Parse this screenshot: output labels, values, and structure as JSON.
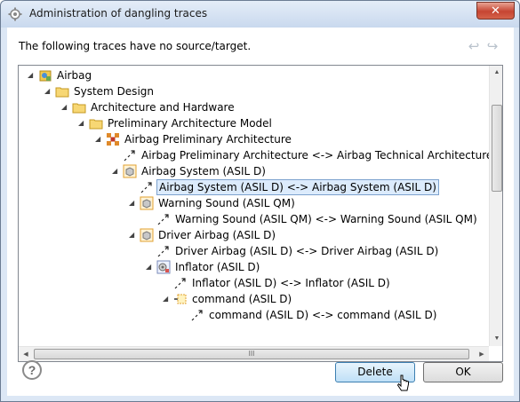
{
  "window": {
    "title": "Administration of dangling traces",
    "close_label": "✕"
  },
  "message": "The following traces have no source/target.",
  "tree": {
    "nodes": [
      {
        "label": "Airbag",
        "icon": "project-icon",
        "toggle": "◢"
      },
      {
        "label": "System Design",
        "icon": "folder-icon",
        "toggle": "◢"
      },
      {
        "label": "Architecture and Hardware",
        "icon": "folder-icon",
        "toggle": "◢"
      },
      {
        "label": "Preliminary Architecture Model",
        "icon": "folder-icon",
        "toggle": "◢"
      },
      {
        "label": "Airbag Preliminary Architecture",
        "icon": "architecture-icon",
        "toggle": "◢"
      },
      {
        "label": "Airbag Preliminary Architecture <-> Airbag Technical Architecture",
        "icon": "trace-icon",
        "toggle": ""
      },
      {
        "label": "Airbag System (ASIL D)",
        "icon": "system-icon",
        "toggle": "◢"
      },
      {
        "label": "Airbag System (ASIL D) <-> Airbag System (ASIL D)",
        "icon": "trace-icon",
        "toggle": ""
      },
      {
        "label": "Warning Sound (ASIL QM)",
        "icon": "component-icon",
        "toggle": "◢"
      },
      {
        "label": "Warning Sound (ASIL QM) <-> Warning Sound (ASIL QM)",
        "icon": "trace-icon",
        "toggle": ""
      },
      {
        "label": "Driver Airbag (ASIL D)",
        "icon": "component-icon",
        "toggle": "◢"
      },
      {
        "label": "Driver Airbag (ASIL D) <-> Driver Airbag (ASIL D)",
        "icon": "trace-icon",
        "toggle": ""
      },
      {
        "label": "Inflator (ASIL D)",
        "icon": "gear-component-icon",
        "toggle": "◢"
      },
      {
        "label": "Inflator (ASIL D) <-> Inflator (ASIL D)",
        "icon": "trace-icon",
        "toggle": ""
      },
      {
        "label": "command (ASIL D)",
        "icon": "port-icon",
        "toggle": "◢"
      },
      {
        "label": "command (ASIL D) <-> command (ASIL D)",
        "icon": "trace-icon",
        "toggle": ""
      }
    ],
    "selected_index": 7
  },
  "scroll": {
    "h_grip": "III"
  },
  "buttons": {
    "help_label": "?",
    "delete_label": "Delete",
    "ok_label": "OK"
  },
  "colors": {
    "selection": "#dcebfc",
    "folder": "#f3c94e",
    "accent": "#3c7fb1"
  }
}
